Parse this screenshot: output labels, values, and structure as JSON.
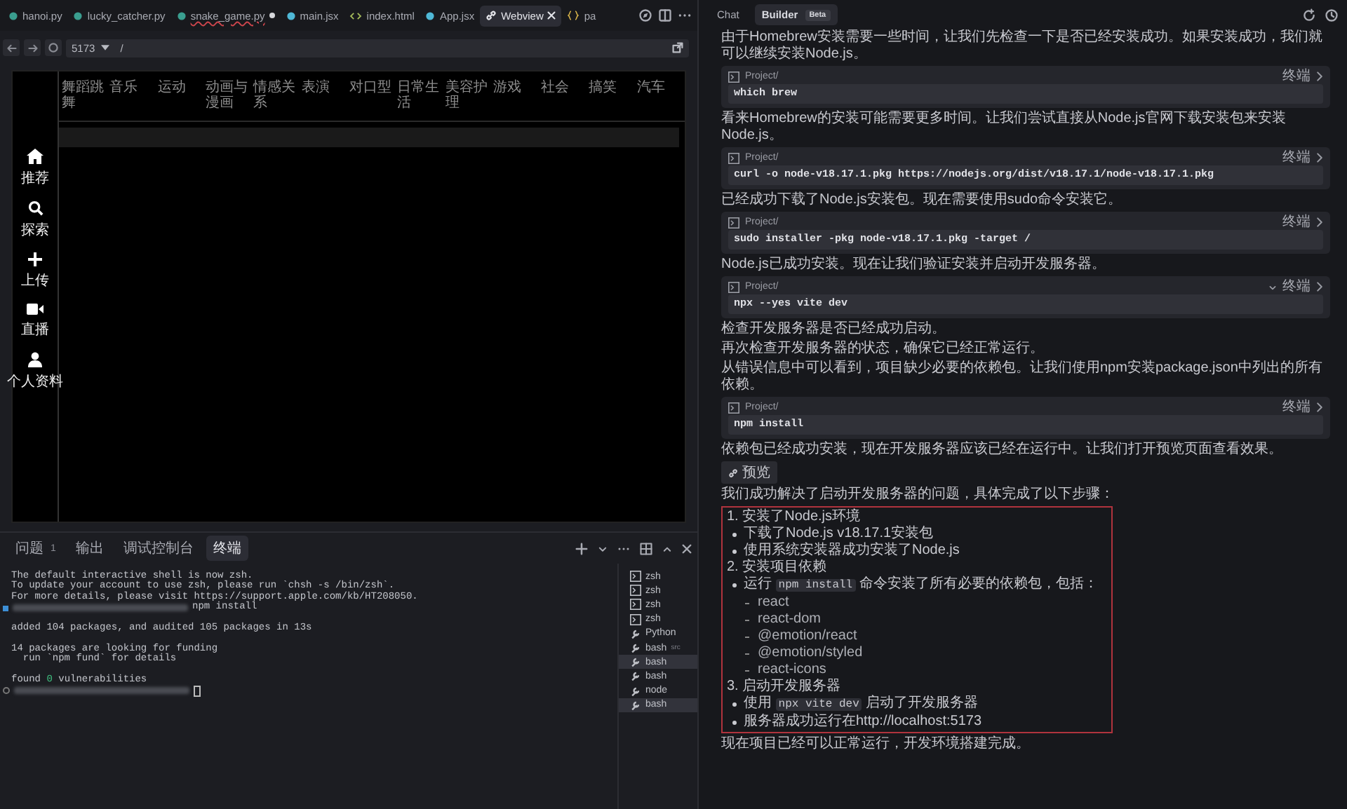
{
  "editor_tabs": [
    {
      "label": "hanoi.py",
      "kind": "python",
      "selected": false,
      "modified": false,
      "error": false
    },
    {
      "label": "lucky_catcher.py",
      "kind": "python",
      "selected": false,
      "modified": false,
      "error": false
    },
    {
      "label": "snake_game.py",
      "kind": "python",
      "selected": false,
      "modified": true,
      "error": true
    },
    {
      "label": "main.jsx",
      "kind": "react",
      "selected": false,
      "modified": false,
      "error": false
    },
    {
      "label": "index.html",
      "kind": "html",
      "selected": false,
      "modified": false,
      "error": false
    },
    {
      "label": "App.jsx",
      "kind": "react",
      "selected": false,
      "modified": false,
      "error": false
    },
    {
      "label": "Webview",
      "kind": "webview",
      "selected": true,
      "modified": false,
      "error": false
    },
    {
      "label": "pa",
      "kind": "json",
      "selected": false,
      "modified": false,
      "error": false
    }
  ],
  "address_bar": {
    "port": "5173",
    "path": "/"
  },
  "webview": {
    "categories": [
      "舞蹈跳舞",
      "音乐",
      "运动",
      "动画与漫画",
      "情感关系",
      "表演",
      "对口型",
      "日常生活",
      "美容护理",
      "游戏",
      "社会",
      "搞笑",
      "汽车"
    ],
    "nav": [
      {
        "label": "推荐",
        "kind": "home"
      },
      {
        "label": "探索",
        "kind": "search"
      },
      {
        "label": "上传",
        "kind": "plus"
      },
      {
        "label": "直播",
        "kind": "video"
      },
      {
        "label": "个人资料",
        "kind": "user"
      }
    ]
  },
  "panel": {
    "tabs": [
      {
        "label": "问题",
        "badge": "1",
        "selected": false
      },
      {
        "label": "输出",
        "selected": false
      },
      {
        "label": "调试控制台",
        "selected": false
      },
      {
        "label": "终端",
        "selected": true
      }
    ],
    "terminal_lines": [
      {
        "kind": "text",
        "text": "The default interactive shell is now zsh."
      },
      {
        "kind": "text",
        "text": "To update your account to use zsh, please run `chsh -s /bin/zsh`."
      },
      {
        "kind": "text",
        "text": "For more details, please visit https://support.apple.com/kb/HT208050."
      },
      {
        "kind": "prompt",
        "finished": true,
        "command": "npm install",
        "cursor": false
      },
      {
        "kind": "blank"
      },
      {
        "kind": "text",
        "text": "added 104 packages, and audited 105 packages in 13s"
      },
      {
        "kind": "blank"
      },
      {
        "kind": "text",
        "text": "14 packages are looking for funding"
      },
      {
        "kind": "text",
        "text": "  run `npm fund` for details"
      },
      {
        "kind": "blank"
      },
      {
        "kind": "segments",
        "parts": [
          {
            "text": "found ",
            "highlight": false
          },
          {
            "text": "0",
            "highlight": true
          },
          {
            "text": " vulnerabilities",
            "highlight": false
          }
        ]
      },
      {
        "kind": "prompt",
        "finished": false,
        "cursor": true
      }
    ],
    "terminals": [
      {
        "label": "zsh",
        "kind": "shell",
        "selected": false
      },
      {
        "label": "zsh",
        "kind": "shell",
        "selected": false
      },
      {
        "label": "zsh",
        "kind": "shell",
        "selected": false
      },
      {
        "label": "zsh",
        "kind": "shell",
        "selected": false
      },
      {
        "label": "Python",
        "kind": "task",
        "selected": false
      },
      {
        "label": "bash",
        "kind": "task",
        "folder": "src",
        "selected": false
      },
      {
        "label": "bash",
        "kind": "task",
        "selected": true
      },
      {
        "label": "bash",
        "kind": "task",
        "selected": false
      },
      {
        "label": "node",
        "kind": "task",
        "selected": false
      },
      {
        "label": "bash",
        "kind": "task",
        "selected": true
      }
    ]
  },
  "chat": {
    "tabs": [
      {
        "label": "Chat",
        "selected": false
      },
      {
        "label": "Builder",
        "badge": "Beta",
        "selected": true
      }
    ],
    "messages": [
      {
        "kind": "text",
        "text": "由于Homebrew安装需要一些时间，让我们先检查一下是否已经安装成功。如果安装成功，我们就可以继续安装Node.js。"
      },
      {
        "kind": "code",
        "path": "Project/",
        "action": "终端",
        "command": "which brew",
        "expanded": false
      },
      {
        "kind": "text",
        "text": "看来Homebrew的安装可能需要更多时间。让我们尝试直接从Node.js官网下载安装包来安装Node.js。"
      },
      {
        "kind": "code",
        "path": "Project/",
        "action": "终端",
        "command": "curl -o node-v18.17.1.pkg https://nodejs.org/dist/v18.17.1/node-v18.17.1.pkg",
        "expanded": false
      },
      {
        "kind": "text",
        "text": "已经成功下载了Node.js安装包。现在需要使用sudo命令安装它。"
      },
      {
        "kind": "code",
        "path": "Project/",
        "action": "终端",
        "command": "sudo installer -pkg node-v18.17.1.pkg -target /",
        "expanded": false
      },
      {
        "kind": "text",
        "text": "Node.js已成功安装。现在让我们验证安装并启动开发服务器。"
      },
      {
        "kind": "code",
        "path": "Project/",
        "action": "终端",
        "command": "npx --yes vite dev",
        "expanded": true
      },
      {
        "kind": "text",
        "text": "检查开发服务器是否已经成功启动。"
      },
      {
        "kind": "text",
        "text": "再次检查开发服务器的状态，确保它已经正常运行。"
      },
      {
        "kind": "text",
        "text": "从错误信息中可以看到，项目缺少必要的依赖包。让我们使用npm安装package.json中列出的所有依赖。"
      },
      {
        "kind": "code",
        "path": "Project/",
        "action": "终端",
        "command": "npm install",
        "expanded": false
      },
      {
        "kind": "text",
        "text": "依赖包已经成功安装，现在开发服务器应该已经在运行中。让我们打开预览页面查看效果。"
      },
      {
        "kind": "preview",
        "label": "预览"
      },
      {
        "kind": "text",
        "text": "我们成功解决了启动开发服务器的问题，具体完成了以下步骤："
      },
      {
        "kind": "steps",
        "highlighted": true,
        "items": [
          {
            "text": "1. 安装了Node.js环境",
            "children": [
              {
                "text": "下载了Node.js v18.17.1安装包"
              },
              {
                "text": "使用系统安装器成功安装了Node.js"
              }
            ]
          },
          {
            "text": "2. 安装项目依赖",
            "children": [
              {
                "parts": [
                  {
                    "text": "运行 ",
                    "code": false
                  },
                  {
                    "text": "npm install",
                    "code": true
                  },
                  {
                    "text": " 命令安装了所有必要的依赖包，包括：",
                    "code": false
                  }
                ],
                "children": [
                  {
                    "text": "react"
                  },
                  {
                    "text": "react-dom"
                  },
                  {
                    "text": "@emotion/react"
                  },
                  {
                    "text": "@emotion/styled"
                  },
                  {
                    "text": "react-icons"
                  }
                ]
              }
            ]
          },
          {
            "text": "3. 启动开发服务器",
            "children": [
              {
                "parts": [
                  {
                    "text": "使用 ",
                    "code": false
                  },
                  {
                    "text": "npx vite dev",
                    "code": true
                  },
                  {
                    "text": " 启动了开发服务器",
                    "code": false
                  }
                ]
              },
              {
                "text": "服务器成功运行在http://localhost:5173"
              }
            ]
          }
        ]
      },
      {
        "kind": "text",
        "text": "现在项目已经可以正常运行，开发环境搭建完成。"
      }
    ]
  }
}
